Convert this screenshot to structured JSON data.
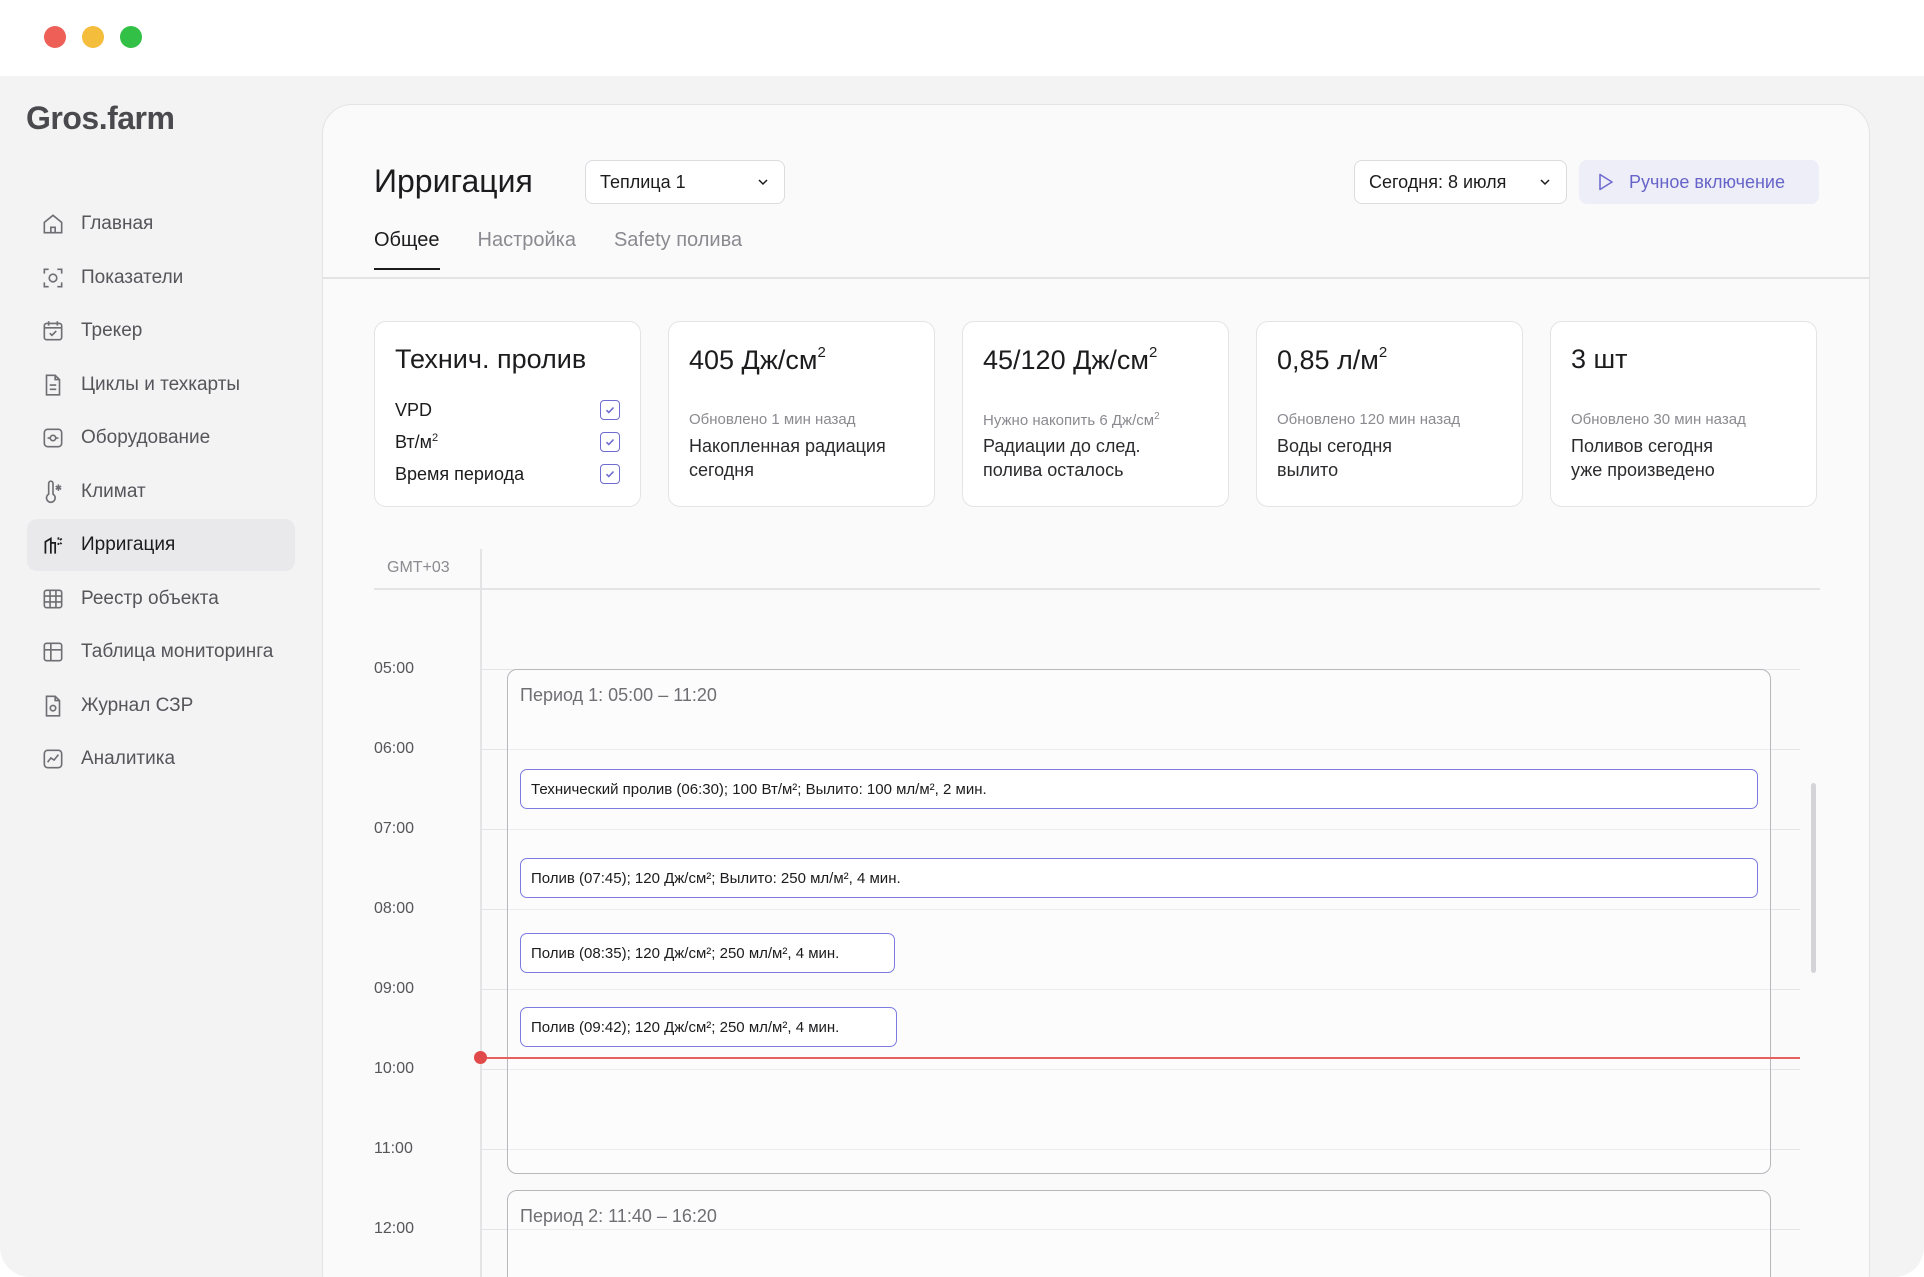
{
  "app": {
    "logo": "Gros.farm"
  },
  "sidebar": {
    "items": [
      {
        "label": "Главная",
        "icon": "home-icon",
        "active": false
      },
      {
        "label": "Показатели",
        "icon": "metrics-icon",
        "active": false
      },
      {
        "label": "Трекер",
        "icon": "calendar-check-icon",
        "active": false
      },
      {
        "label": "Циклы и техкарты",
        "icon": "document-icon",
        "active": false
      },
      {
        "label": "Оборудование",
        "icon": "equipment-icon",
        "active": false
      },
      {
        "label": "Климат",
        "icon": "thermometer-icon",
        "active": false
      },
      {
        "label": "Ирригация",
        "icon": "irrigation-icon",
        "active": true
      },
      {
        "label": "Реестр объекта",
        "icon": "grid-icon",
        "active": false
      },
      {
        "label": "Таблица мониторинга",
        "icon": "table-icon",
        "active": false
      },
      {
        "label": "Журнал СЗР",
        "icon": "journal-icon",
        "active": false
      },
      {
        "label": "Аналитика",
        "icon": "analytics-icon",
        "active": false
      }
    ]
  },
  "header": {
    "title": "Ирригация",
    "greenhouse_select": "Теплица 1",
    "date_select": "Сегодня: 8 июля",
    "manual_button": "Ручное включение"
  },
  "tabs": [
    {
      "label": "Общее",
      "active": true
    },
    {
      "label": "Настройка",
      "active": false
    },
    {
      "label": "Safety полива",
      "active": false
    }
  ],
  "cards": {
    "tech": {
      "title": "Технич. пролив",
      "rows": [
        {
          "label": "VPD",
          "sup": "",
          "checked": true
        },
        {
          "label": "Вт/м",
          "sup": "2",
          "checked": true
        },
        {
          "label": "Время периода",
          "sup": "",
          "checked": true
        }
      ]
    },
    "radiation": {
      "value": "405 Дж/см",
      "value_sup": "2",
      "updated": "Обновлено 1 мин назад",
      "desc1": "Накопленная радиация",
      "desc2": "сегодня"
    },
    "radiation_left": {
      "value": "45/120 Дж/см",
      "value_sup": "2",
      "updated": "Нужно накопить 6 Дж/см",
      "updated_sup": "2",
      "desc1": "Радиации до след.",
      "desc2": "полива осталось"
    },
    "water": {
      "value": "0,85 л/м",
      "value_sup": "2",
      "updated": "Обновлено 120 мин назад",
      "desc1": "Воды сегодня",
      "desc2": "вылито"
    },
    "count": {
      "value": "3 шт",
      "updated": "Обновлено 30 мин назад",
      "desc1": "Поливов сегодня",
      "desc2": "уже произведено"
    }
  },
  "schedule": {
    "timezone": "GMT+03",
    "hours": [
      "05:00",
      "06:00",
      "07:00",
      "08:00",
      "09:00",
      "10:00",
      "11:00",
      "12:00"
    ],
    "current_time": "09:48",
    "periods": [
      {
        "title": "Период 1: 05:00 – 11:20",
        "events": [
          {
            "text": "Технический пролив (06:30); 100 Вт/м²; Вылито: 100 мл/м², 2 мин."
          },
          {
            "text": "Полив (07:45); 120 Дж/см²; Вылито: 250 мл/м², 4 мин."
          },
          {
            "text": "Полив (08:35); 120 Дж/см²; 250 мл/м², 4 мин."
          },
          {
            "text": "Полив (09:42); 120 Дж/см²; 250 мл/м², 4 мин."
          }
        ]
      },
      {
        "title": "Период 2: 11:40 – 16:20",
        "events": []
      }
    ]
  },
  "colors": {
    "accent": "#6f6cd0",
    "now_line": "#e66060",
    "manual_bg": "#eeeef8"
  }
}
